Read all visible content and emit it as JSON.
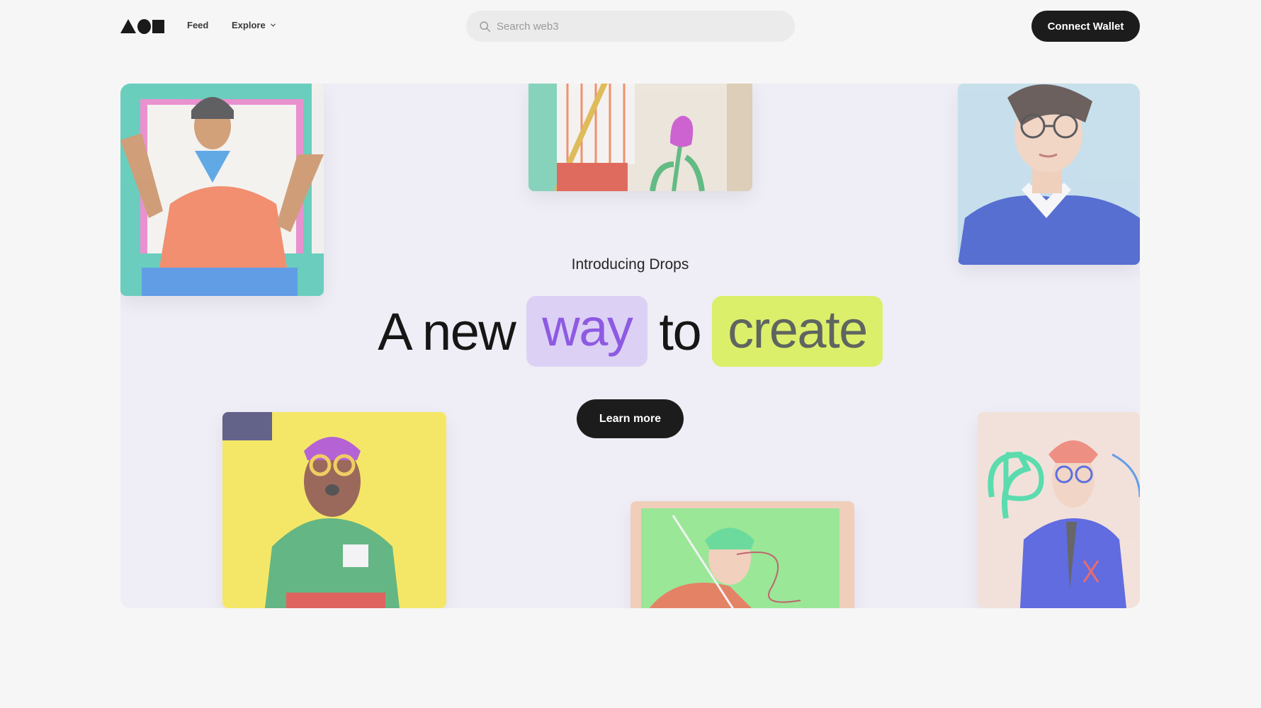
{
  "header": {
    "logo_icon": "triangle-circle-square-logo",
    "nav": {
      "feed": "Feed",
      "explore": "Explore"
    },
    "search": {
      "placeholder": "Search web3",
      "icon": "search-icon"
    },
    "connect_wallet": "Connect Wallet"
  },
  "hero": {
    "intro": "Introducing Drops",
    "headline": {
      "part1": "A new",
      "highlight1": "way",
      "part2": "to",
      "highlight2": "create"
    },
    "cta": "Learn more",
    "colors": {
      "way_bg": "#dcd1f5",
      "way_text": "#8e5ae2",
      "create_bg": "#dcef6a",
      "hero_bg": "#efedf5",
      "button": "#1c1c1c"
    }
  }
}
